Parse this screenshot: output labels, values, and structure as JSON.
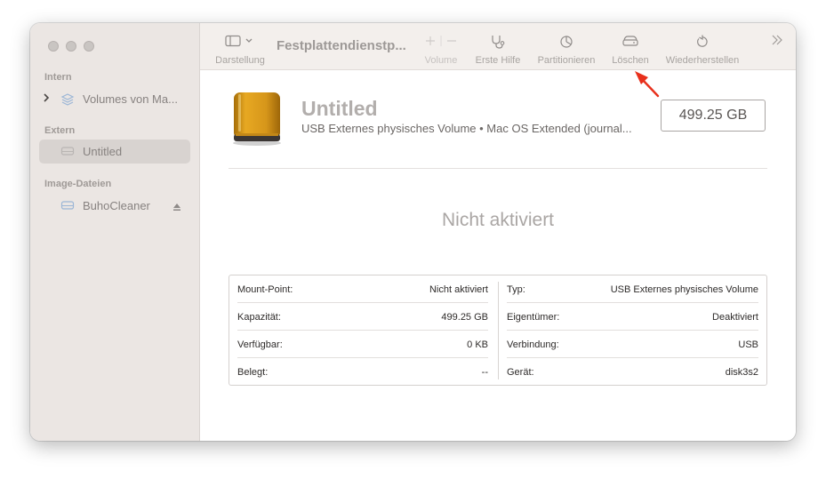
{
  "sidebar": {
    "sections": [
      {
        "label": "Intern",
        "items": [
          {
            "label": "Volumes von Ma...",
            "icon": "layers-icon",
            "has_disclosure": true
          }
        ]
      },
      {
        "label": "Extern",
        "items": [
          {
            "label": "Untitled",
            "icon": "external-drive-icon",
            "selected": true
          }
        ]
      },
      {
        "label": "Image-Dateien",
        "items": [
          {
            "label": "BuhoCleaner",
            "icon": "disk-image-icon",
            "eject": true
          }
        ]
      }
    ]
  },
  "toolbar": {
    "title": "Festplattendienstp...",
    "view_label": "Darstellung",
    "volume_label": "Volume",
    "first_aid_label": "Erste Hilfe",
    "partition_label": "Partitionieren",
    "erase_label": "Löschen",
    "restore_label": "Wiederherstellen",
    "more_label": "»"
  },
  "volume": {
    "name": "Untitled",
    "subtitle": "USB Externes physisches Volume • Mac OS Extended (journal...",
    "capacity": "499.25 GB",
    "status": "Nicht aktiviert"
  },
  "info": {
    "left": [
      {
        "key": "Mount-Point:",
        "value": "Nicht aktiviert"
      },
      {
        "key": "Kapazität:",
        "value": "499.25 GB"
      },
      {
        "key": "Verfügbar:",
        "value": "0 KB"
      },
      {
        "key": "Belegt:",
        "value": "--"
      }
    ],
    "right": [
      {
        "key": "Typ:",
        "value": "USB Externes physisches Volume"
      },
      {
        "key": "Eigentümer:",
        "value": "Deaktiviert"
      },
      {
        "key": "Verbindung:",
        "value": "USB"
      },
      {
        "key": "Gerät:",
        "value": "disk3s2"
      }
    ]
  },
  "colors": {
    "annotation_arrow": "#e8301c",
    "drive_gold": "#d99a18"
  }
}
